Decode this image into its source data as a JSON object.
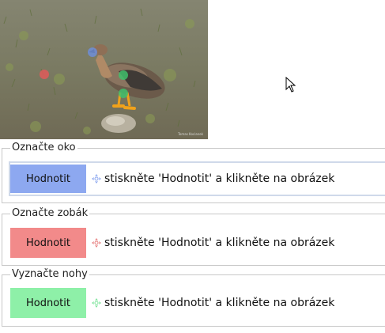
{
  "photo": {
    "credit": "Tomas Kocianek",
    "markers": [
      {
        "name": "eye-marker",
        "color": "#6f8ed8"
      },
      {
        "name": "beak-marker",
        "color": "#e05a5a"
      },
      {
        "name": "leg-marker-1",
        "color": "#41c06b"
      },
      {
        "name": "leg-marker-2",
        "color": "#41c06b"
      }
    ]
  },
  "tasks": [
    {
      "title": "Označte oko",
      "button": "Hodnotit",
      "hint": "stiskněte 'Hodnotit' a klikněte na obrázek",
      "color": "#8da8f0",
      "icon_color": "#8da8f0"
    },
    {
      "title": "Označte zobák",
      "button": "Hodnotit",
      "hint": "stiskněte 'Hodnotit' a klikněte na obrázek",
      "color": "#f28a8a",
      "icon_color": "#e77f7f"
    },
    {
      "title": "Vyznačte nohy",
      "button": "Hodnotit",
      "hint": "stiskněte 'Hodnotit' a klikněte na obrázek",
      "color": "#8ef0a8",
      "icon_color": "#7de49b"
    }
  ]
}
